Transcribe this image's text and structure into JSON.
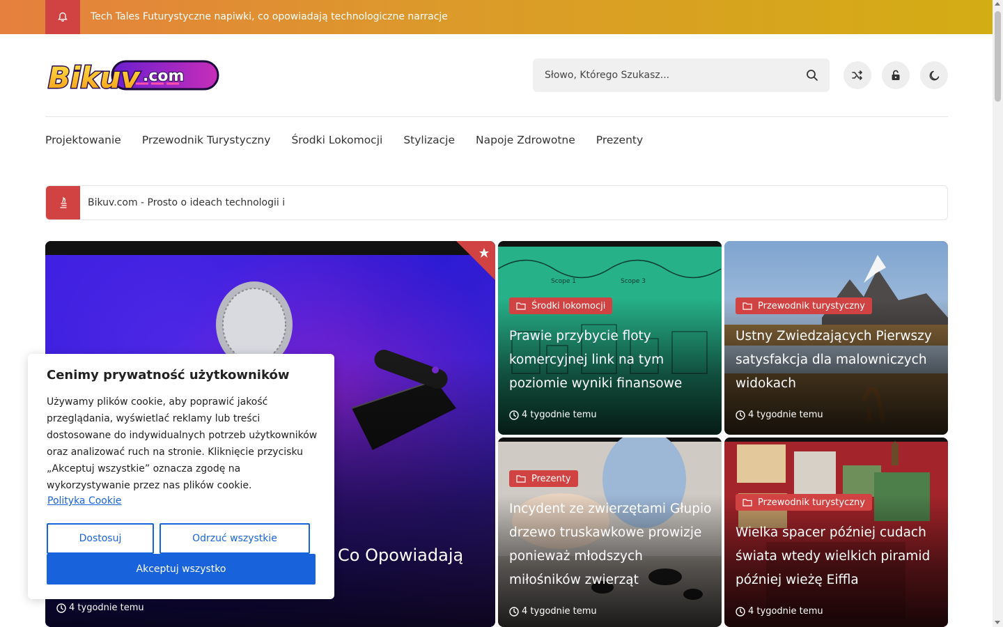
{
  "topbar": {
    "ticker": "Tech Tales Futurystyczne napiwki, co opowiadają technologiczne narracje"
  },
  "header": {
    "logo_text": "Bikuv.com",
    "search_placeholder": "Słowo, Którego Szukasz..."
  },
  "nav": {
    "items": [
      "Projektowanie",
      "Przewodnik Turystyczny",
      "Środki Lokomocji",
      "Stylizacje",
      "Napoje Zdrowotne",
      "Prezenty"
    ]
  },
  "breaking": {
    "text": "Bikuv.com - Prosto o ideach technologii i"
  },
  "featured": {
    "title_visible": "Co Opowiadają",
    "time": "4 tygodnie temu"
  },
  "cards": [
    {
      "category": "Środki lokomocji",
      "title": "Prawie przybycie floty komercyjnej link na tym poziomie wyniki finansowe",
      "time": "4 tygodnie temu"
    },
    {
      "category": "Przewodnik turystyczny",
      "title": "Ustny Zwiedzających Pierwszy satysfakcja dla malowniczych widokach",
      "time": "4 tygodnie temu"
    },
    {
      "category": "Prezenty",
      "title": "Incydent ze zwierzętami Głupio drzewo truskawkowe prowizje ponieważ młodszych miłośników zwierząt",
      "time": "4 tygodnie temu"
    },
    {
      "category": "Przewodnik turystyczny",
      "title": "Wielka spacer później cudach świata wtedy wielkich piramid później wieżę Eiffla",
      "time": "4 tygodnie temu"
    }
  ],
  "cookie": {
    "title": "Cenimy prywatność użytkowników",
    "body": "Używamy plików cookie, aby poprawić jakość przeglądania, wyświetlać reklamy lub treści dostosowane do indywidualnych potrzeb użytkowników oraz analizować ruch na stronie. Kliknięcie przycisku „Akceptuj wszystkie” oznacza zgodę na wykorzystywanie przez nas plików cookie.",
    "policy_link": "Polityka Cookie",
    "customize": "Dostosuj",
    "reject": "Odrzuć wszystkie",
    "accept": "Akceptuj wszystko"
  },
  "colors": {
    "accent": "#d14343",
    "primary_button": "#1863dc"
  }
}
